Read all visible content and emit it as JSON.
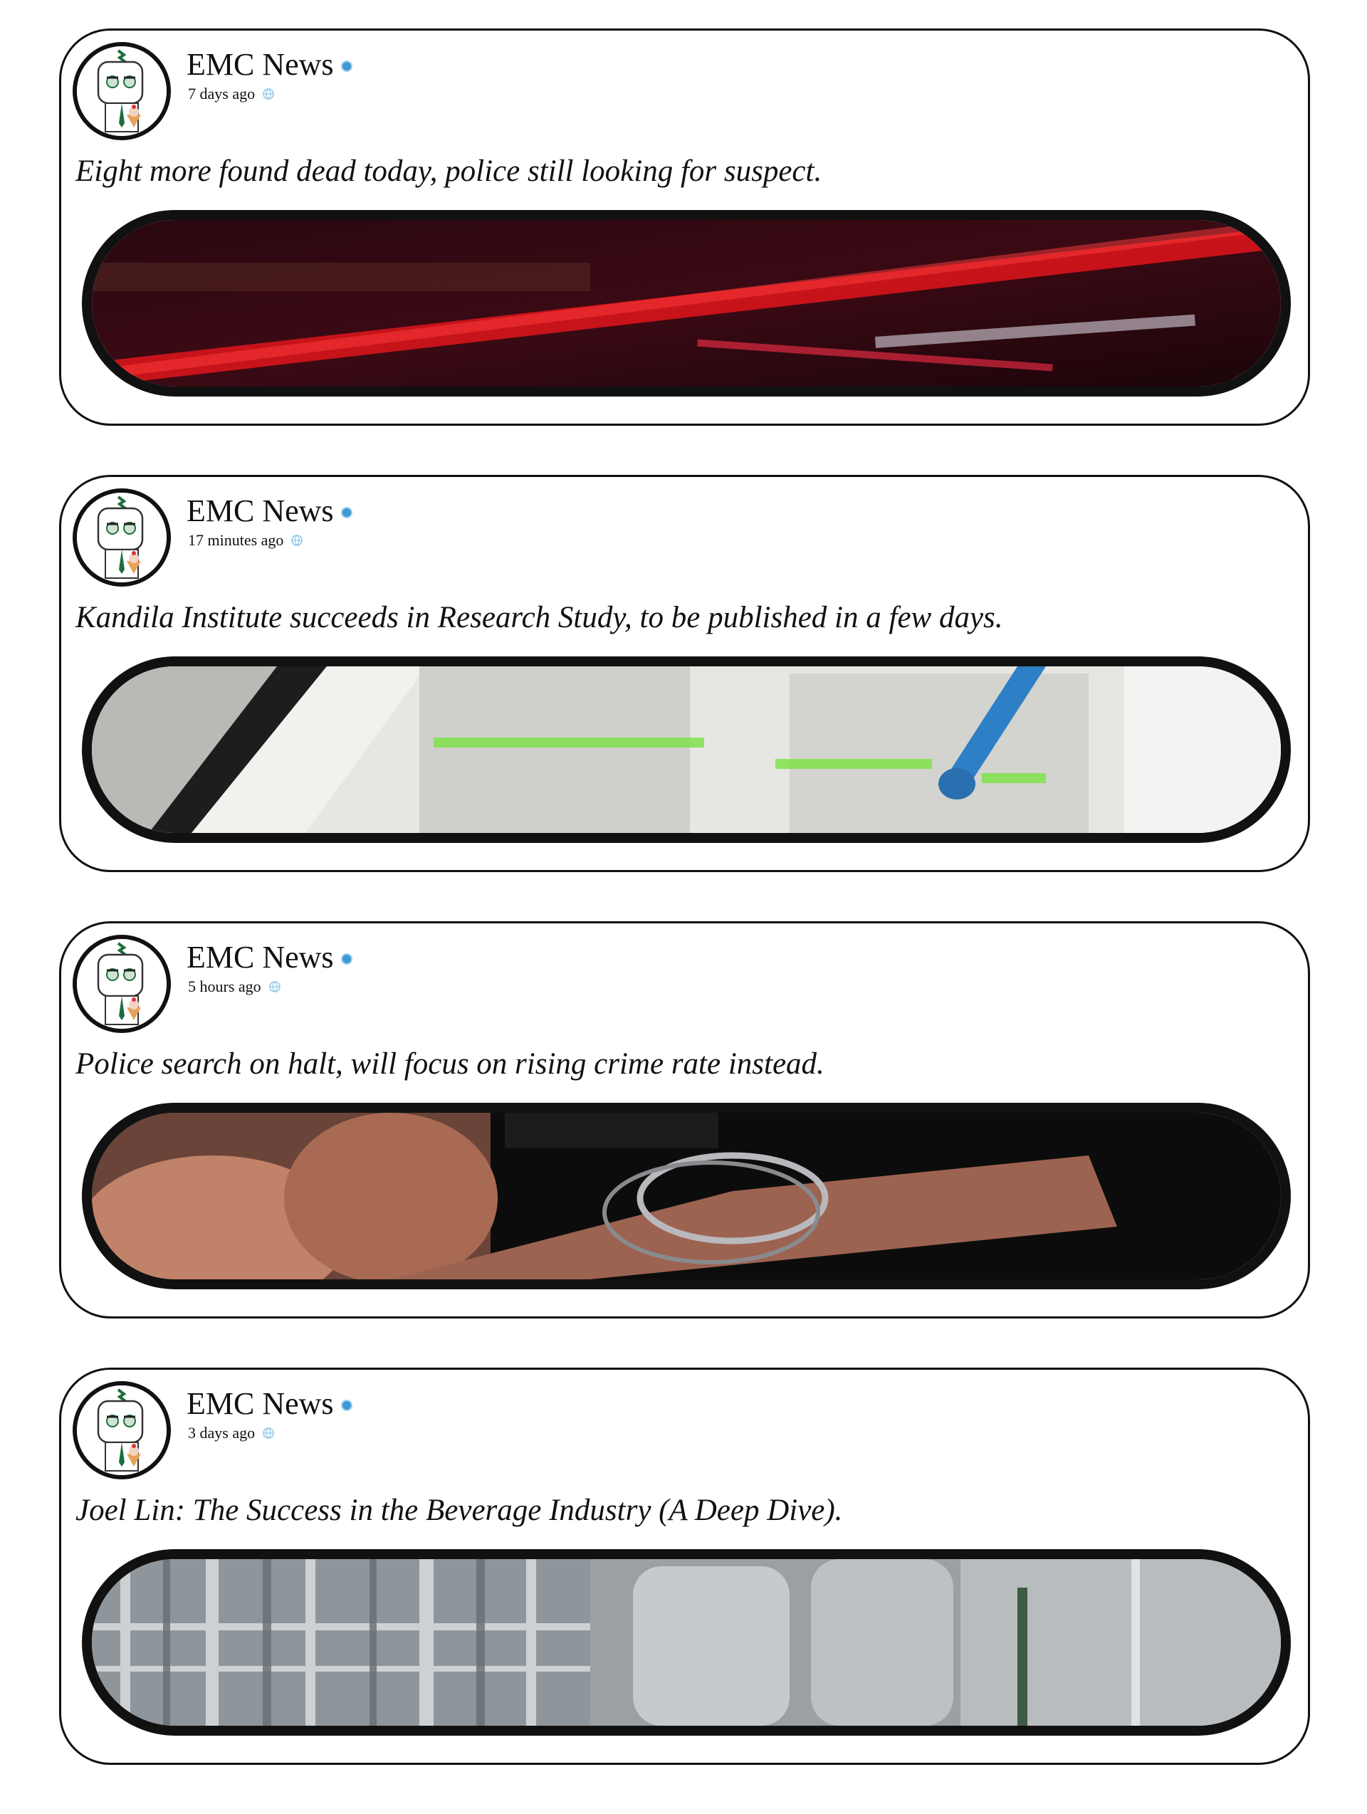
{
  "posts": [
    {
      "author": "EMC News",
      "time": "7 days ago",
      "headline": "Eight more found dead today, police still looking for suspect.",
      "image": "crime-scene-tape-photo"
    },
    {
      "author": "EMC News",
      "time": "17 minutes ago",
      "headline": "Kandila Institute succeeds in Research Study, to be published in a few days.",
      "image": "highlighted-research-paper-photo"
    },
    {
      "author": "EMC News",
      "time": "5 hours ago",
      "headline": "Police search on halt, will focus on rising crime rate instead.",
      "image": "handcuffed-wrists-photo"
    },
    {
      "author": "EMC News",
      "time": "3 days ago",
      "headline": "Joel Lin: The Success in the Beverage Industry (A Deep Dive).",
      "image": "beverage-factory-photo"
    }
  ],
  "icons": {
    "verified": "verified-badge-icon",
    "audience": "globe-icon",
    "avatar": "mascot-avatar"
  },
  "colors": {
    "verified_badge": "#3f9ad3",
    "avatar_accent": "#1d6e3c"
  }
}
